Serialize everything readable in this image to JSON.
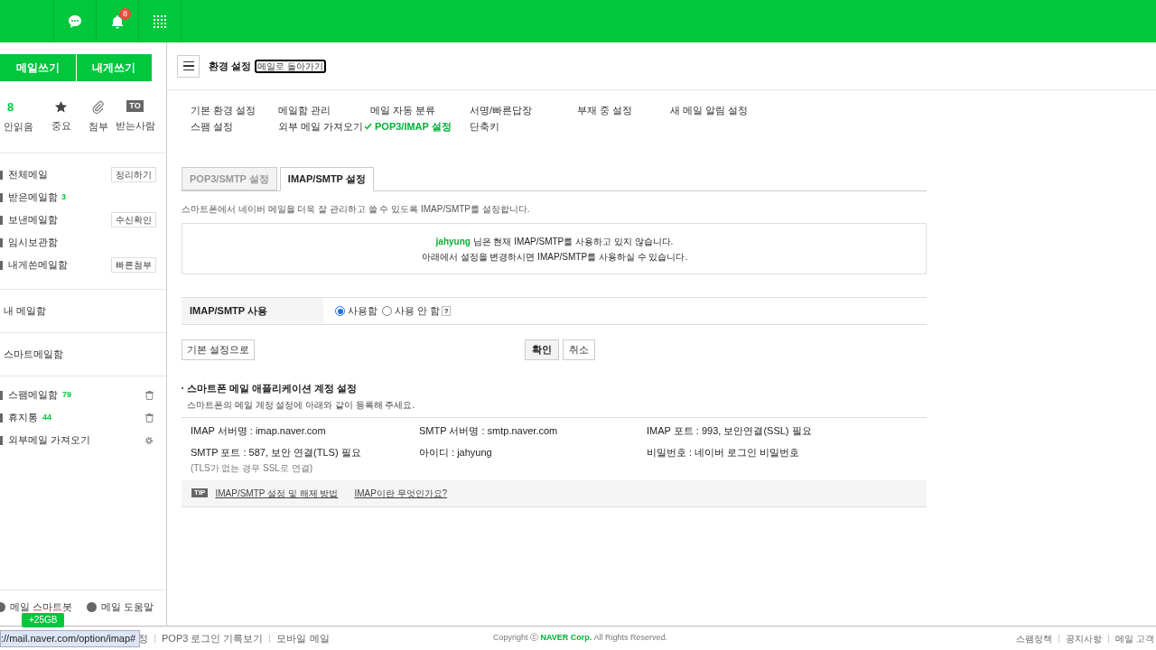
{
  "header": {
    "notification_count": "8"
  },
  "sidebar": {
    "compose_buttons": [
      "메일쓰기",
      "내게쓰기"
    ],
    "quick_filters": [
      {
        "kind": "count",
        "value": "8",
        "label": "안읽음"
      },
      {
        "kind": "star",
        "label": "중요"
      },
      {
        "kind": "clip",
        "label": "첨부"
      },
      {
        "kind": "to",
        "badge": "TO",
        "label": "받는사람"
      }
    ],
    "folders": [
      {
        "name": "전체메일",
        "action": "정리하기"
      },
      {
        "name": "받은메일함",
        "count": "3"
      },
      {
        "name": "보낸메일함",
        "action": "수신확인"
      },
      {
        "name": "임시보관함"
      },
      {
        "name": "내게쓴메일함",
        "action": "빠른첨부"
      }
    ],
    "my_mailbox": "내 메일함",
    "smart_mailbox": "스마트메일함",
    "extra_folders": [
      {
        "name": "스팸메일함",
        "count": "79",
        "kind": "trash"
      },
      {
        "name": "휴지통",
        "count": "44",
        "kind": "trash"
      },
      {
        "name": "외부메일 가져오기",
        "kind": "gear"
      }
    ],
    "bottom_links": [
      "메일 스마트봇",
      "메일 도움말"
    ],
    "storage_badge": "+25GB"
  },
  "main": {
    "title": "환경 설정",
    "back_link": "메일로 돌아가기",
    "settings_menu": [
      {
        "label": "기본 환경 설정",
        "selected": false
      },
      {
        "label": "메일함 관리",
        "selected": false
      },
      {
        "label": "메일 자동 분류",
        "selected": false
      },
      {
        "label": "서명/빠른답장",
        "selected": false
      },
      {
        "label": "부재 중 설정",
        "selected": false
      },
      {
        "label": "새 메일 알림 설정",
        "selected": false
      },
      {
        "label": "스팸 설정",
        "selected": false
      },
      {
        "label": "외부 메일 가져오기",
        "selected": false
      },
      {
        "label": "POP3/IMAP 설정",
        "selected": true
      },
      {
        "label": "단축키",
        "selected": false
      }
    ],
    "tabs": [
      {
        "label": "POP3/SMTP 설정",
        "selected": false
      },
      {
        "label": "IMAP/SMTP 설정",
        "selected": true
      }
    ],
    "description": "스마트폰에서 네이버 메일을 더욱 잘 관리하고 쓸 수 있도록 IMAP/SMTP를 설정합니다.",
    "notice": {
      "user": "jahyung",
      "line1": " 님은 현재 IMAP/SMTP를 사용하고 있지 않습니다.",
      "line2": "아래에서 설정을 변경하시면 IMAP/SMTP를 사용하실 수 있습니다."
    },
    "setting_row": {
      "label": "IMAP/SMTP 사용",
      "options": [
        {
          "label": "사용함",
          "selected": true
        },
        {
          "label": "사용 안 함",
          "selected": false
        }
      ],
      "help": "?"
    },
    "buttons": {
      "reset": "기본 설정으로",
      "confirm": "확인",
      "cancel": "취소"
    },
    "account_section": {
      "title": "스마트폰 메일 애플리케이션 계정 설정",
      "subtitle": "스마트폰의 메일 계정 설정에 아래와 같이 등록해 주세요.",
      "fields": [
        {
          "text": "IMAP 서버명 : imap.naver.com"
        },
        {
          "text": "SMTP 서버명 : smtp.naver.com"
        },
        {
          "text": "IMAP 포트 : 993, 보안연결(SSL) 필요"
        },
        {
          "text": "SMTP 포트 : 587, 보안 연결(TLS) 필요",
          "note": "(TLS가 없는 경우 SSL로 연결)"
        },
        {
          "text": "아이디 : jahyung"
        },
        {
          "text": "비밀번호 : 네이버 로그인 비밀번호"
        }
      ],
      "tip_badge": "TIP",
      "tip_links": [
        "IMAP/SMTP 설정 및 해제 방법",
        "IMAP이란 무엇인가요?"
      ]
    }
  },
  "footer": {
    "url_tooltip": "://mail.naver.com/option/imap#",
    "left_links": [
      "정",
      "POP3 로그인 기록보기",
      "모바일 메일"
    ],
    "copyright": "Copyright ⓒ **NAVER Corp.** All Rights Reserved.",
    "right_links": [
      "스팸정책",
      "공지사항",
      "메일 고객"
    ]
  }
}
